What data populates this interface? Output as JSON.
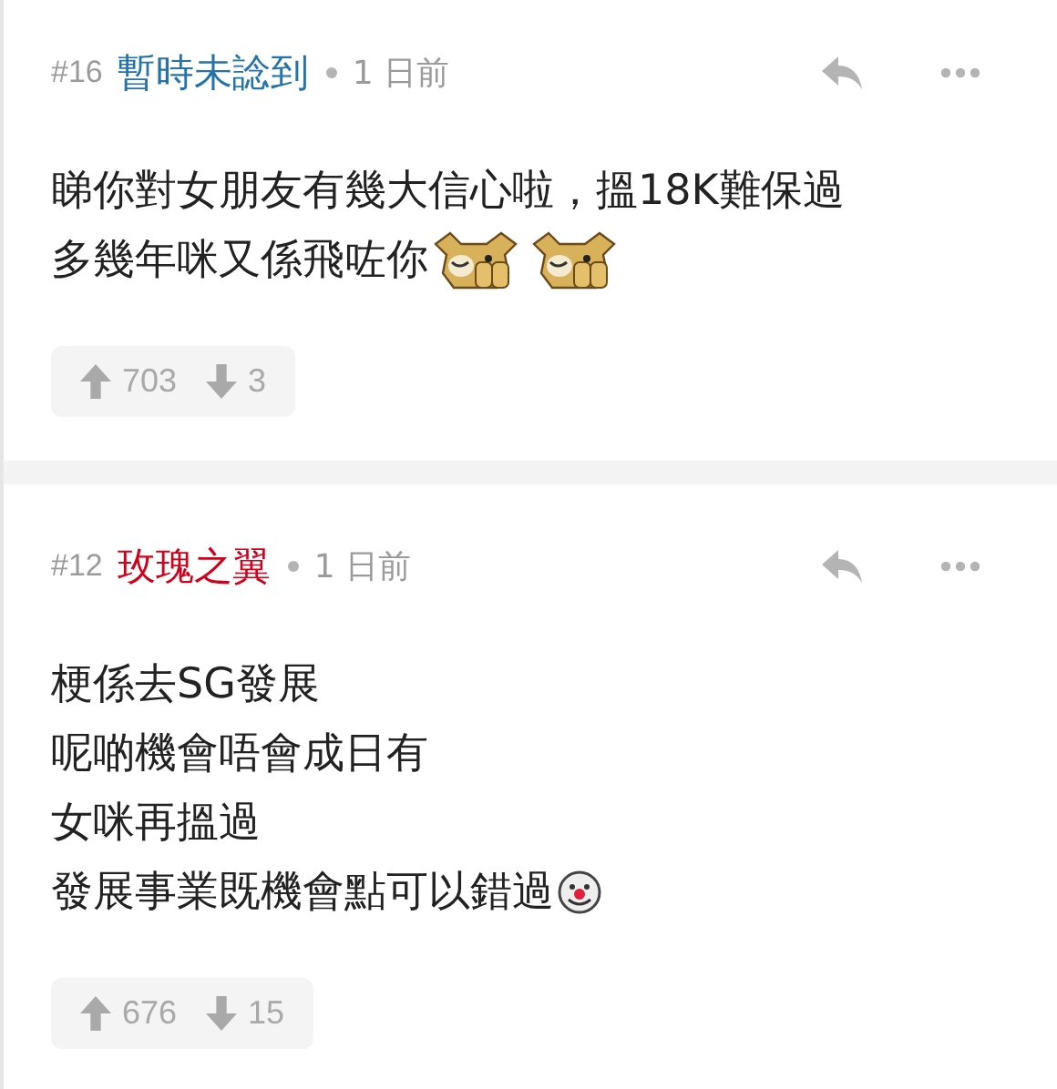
{
  "posts": [
    {
      "number": "#16",
      "author": "暫時未諗到",
      "color": "#2574a9",
      "time": "1 日前",
      "lines": [
        {
          "text": "睇你對女朋友有幾大信心啦，搵18K難保過"
        },
        {
          "text": "多幾年咪又係飛咗你",
          "emoticons": [
            {
              "kind": "dog"
            },
            {
              "kind": "dog"
            }
          ]
        }
      ],
      "upvotes": "703",
      "downvotes": "3"
    },
    {
      "number": "#12",
      "author": "玫瑰之翼",
      "color": "#d0021b",
      "time": "1 日前",
      "lines": [
        {
          "text": "梗係去SG發展"
        },
        {
          "text": "呢啲機會唔會成日有"
        },
        {
          "text": "女咪再搵過"
        },
        {
          "text": "發展事業既機會點可以錯過",
          "emoticons": [
            {
              "kind": "clown"
            }
          ]
        }
      ],
      "upvotes": "676",
      "downvotes": "15"
    }
  ]
}
